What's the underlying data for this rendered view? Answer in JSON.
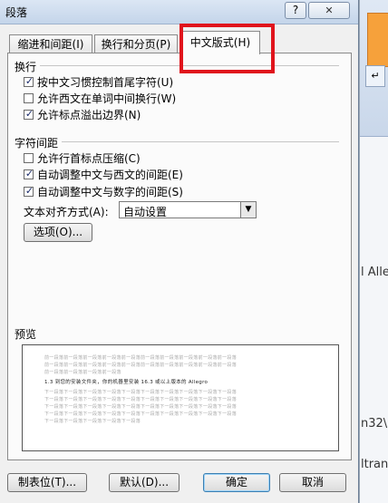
{
  "dialog": {
    "title": "段落",
    "help_label": "?",
    "close_icon": "close-icon"
  },
  "tabs": [
    {
      "label": "缩进和间距(I)",
      "active": false
    },
    {
      "label": "换行和分页(P)",
      "active": false
    },
    {
      "label": "中文版式(H)",
      "active": true
    }
  ],
  "line_break": {
    "heading": "换行",
    "options": [
      {
        "label": "按中文习惯控制首尾字符(U)",
        "checked": true
      },
      {
        "label": "允许西文在单词中间换行(W)",
        "checked": false
      },
      {
        "label": "允许标点溢出边界(N)",
        "checked": true
      }
    ]
  },
  "char_spacing": {
    "heading": "字符间距",
    "options": [
      {
        "label": "允许行首标点压缩(C)",
        "checked": false
      },
      {
        "label": "自动调整中文与西文的间距(E)",
        "checked": true
      },
      {
        "label": "自动调整中文与数字的间距(S)",
        "checked": true
      }
    ],
    "text_align_label": "文本对齐方式(A):",
    "text_align_value": "自动设置",
    "options_button": "选项(O)..."
  },
  "preview": {
    "heading": "预览",
    "before_lines": [
      "前一段落前一段落前一段落前一段落前一段落前一段落前一段落前一段落前一段落前一段落",
      "前一段落前一段落前一段落前一段落前一段落前一段落前一段落前一段落前一段落前一段落",
      "前一段落前一段落前一段落前一段落"
    ],
    "main_line": "1.3 到您的安装文件夹，你的机器里安装 16.3 或以上版本的 Allegro",
    "after_lines": [
      "下一段落下一段落下一段落下一段落下一段落下一段落下一段落下一段落下一段落下一段落",
      "下一段落下一段落下一段落下一段落下一段落下一段落下一段落下一段落下一段落下一段落",
      "下一段落下一段落下一段落下一段落下一段落下一段落下一段落下一段落下一段落下一段落",
      "下一段落下一段落下一段落下一段落下一段落下一段落下一段落下一段落下一段落下一段落",
      "下一段落下一段落下一段落下一段落下一段落"
    ]
  },
  "footer": {
    "tabs_button": "制表位(T)...",
    "default_button": "默认(D)...",
    "ok_button": "确定",
    "cancel_button": "取消"
  },
  "background": {
    "text_1": "l Alle",
    "text_2": "n32\\",
    "text_3": "ltrans",
    "text_4": "\\"
  },
  "colors": {
    "highlight": "#e0141c"
  }
}
